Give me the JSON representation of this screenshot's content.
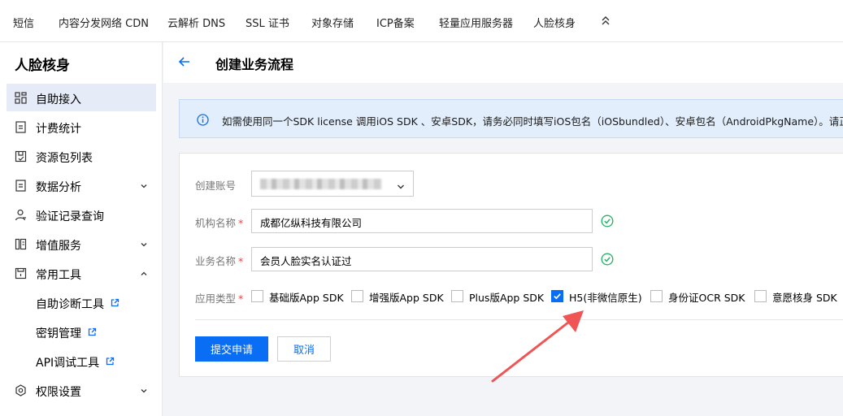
{
  "top_nav": {
    "tabs": [
      "短信",
      "内容分发网络 CDN",
      "云解析 DNS",
      "SSL 证书",
      "对象存储",
      "ICP备案",
      "轻量应用服务器",
      "人脸核身"
    ]
  },
  "sidebar": {
    "title": "人脸核身",
    "items": [
      {
        "label": "自助接入",
        "icon": "grid-icon"
      },
      {
        "label": "计费统计",
        "icon": "document-icon"
      },
      {
        "label": "资源包列表",
        "icon": "box-icon"
      },
      {
        "label": "数据分析",
        "icon": "document-icon"
      },
      {
        "label": "验证记录查询",
        "icon": "user-icon"
      },
      {
        "label": "增值服务",
        "icon": "service-icon"
      },
      {
        "label": "常用工具",
        "icon": "toolbox-icon"
      },
      {
        "label": "权限设置",
        "icon": "settings-icon"
      }
    ],
    "sub_items": [
      {
        "label": "自助诊断工具"
      },
      {
        "label": "密钥管理"
      },
      {
        "label": "API调试工具"
      }
    ]
  },
  "page": {
    "title": "创建业务流程"
  },
  "alert": {
    "text": "如需使用同一个SDK license 调用iOS SDK 、安卓SDK，请务必同时填写iOS包名（iOSbundled）、安卓包名（AndroidPkgName）。请正确填写"
  },
  "form": {
    "account_label": "创建账号",
    "org_label": "机构名称",
    "org_value": "成都亿纵科技有限公司",
    "business_label": "业务名称",
    "business_value": "会员人脸实名认证过",
    "app_type_label": "应用类型",
    "required_mark": "*",
    "app_types": [
      {
        "label": "基础版App SDK",
        "checked": false
      },
      {
        "label": "增强版App SDK",
        "checked": false
      },
      {
        "label": "Plus版App SDK",
        "checked": false
      },
      {
        "label": "H5(非微信原生)",
        "checked": true
      },
      {
        "label": "身份证OCR SDK",
        "checked": false
      },
      {
        "label": "意愿核身 SDK",
        "checked": false
      }
    ],
    "submit_label": "提交申请",
    "cancel_label": "取消"
  },
  "colors": {
    "primary": "#0a6ef5",
    "success": "#2bb36b",
    "required": "#e54545",
    "annotation_arrow": "#f05454"
  }
}
